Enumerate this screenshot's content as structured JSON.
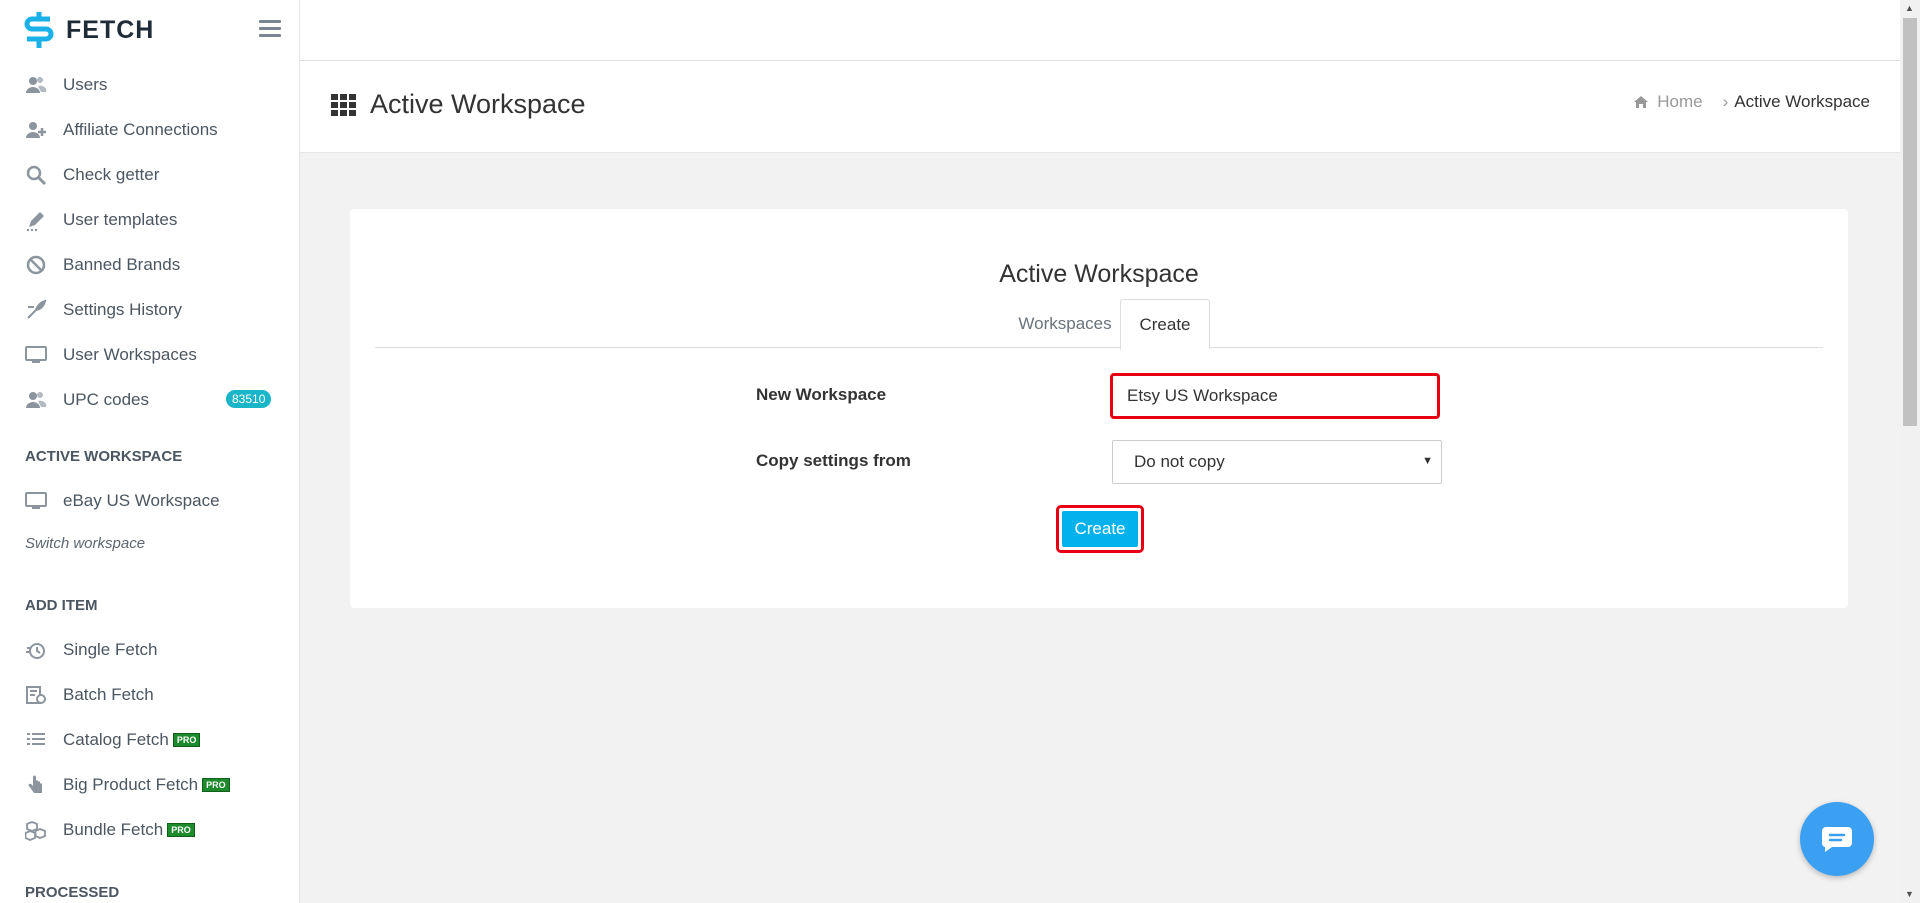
{
  "brand": {
    "name": "FETCH"
  },
  "sidebar": {
    "items": [
      {
        "label": "Users",
        "icon": "users-icon"
      },
      {
        "label": "Affiliate Connections",
        "icon": "add-user-icon"
      },
      {
        "label": "Check getter",
        "icon": "search-icon"
      },
      {
        "label": "User templates",
        "icon": "edit-icon"
      },
      {
        "label": "Banned Brands",
        "icon": "ban-icon"
      },
      {
        "label": "Settings History",
        "icon": "history-icon"
      },
      {
        "label": "User Workspaces",
        "icon": "monitor-icon"
      },
      {
        "label": "UPC codes",
        "icon": "users-icon",
        "badge": "83510"
      }
    ],
    "active_workspace_heading": "ACTIVE WORKSPACE",
    "active_workspace": {
      "label": "eBay US Workspace",
      "icon": "monitor-icon"
    },
    "switch_workspace": "Switch workspace",
    "add_item_heading": "ADD ITEM",
    "add_items": [
      {
        "label": "Single Fetch",
        "icon": "single-fetch-icon"
      },
      {
        "label": "Batch Fetch",
        "icon": "batch-fetch-icon"
      },
      {
        "label": "Catalog Fetch",
        "icon": "list-icon",
        "pro": "PRO"
      },
      {
        "label": "Big Product Fetch",
        "icon": "hand-icon",
        "pro": "PRO"
      },
      {
        "label": "Bundle Fetch",
        "icon": "cubes-icon",
        "pro": "PRO"
      }
    ],
    "processed_heading": "PROCESSED"
  },
  "header": {
    "title": "Active Workspace",
    "breadcrumb": {
      "home": "Home",
      "current": "Active Workspace"
    }
  },
  "card": {
    "title": "Active Workspace",
    "tabs": [
      {
        "label": "Workspaces"
      },
      {
        "label": "Create"
      }
    ],
    "new_workspace_label": "New Workspace",
    "new_workspace_value": "Etsy US Workspace",
    "copy_settings_label": "Copy settings from",
    "copy_settings_value": "Do not copy",
    "create_button": "Create"
  },
  "colors": {
    "accent": "#03b2ec",
    "highlight": "#e60012",
    "badge": "#19b5c9",
    "chat": "#3b9ff2"
  }
}
